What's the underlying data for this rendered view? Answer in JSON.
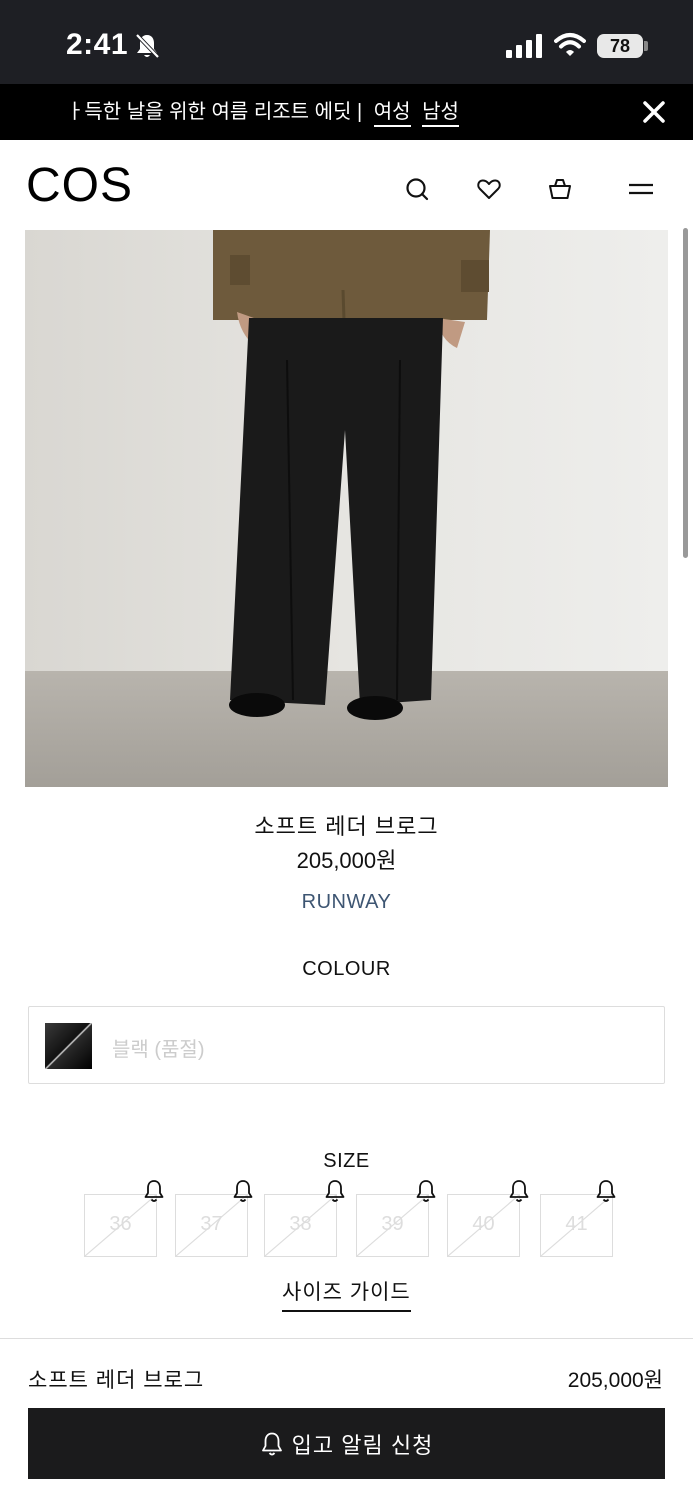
{
  "status_bar": {
    "time": "2:41",
    "battery": "78"
  },
  "promo": {
    "text": "ㅏ득한 날을 위한 여름 리조트 에딧 |",
    "link_women": "여성",
    "link_men": "남성"
  },
  "header": {
    "logo": "COS"
  },
  "product": {
    "title": "소프트 레더 브로그",
    "price": "205,000원",
    "collection": "RUNWAY",
    "colour_label": "COLOUR",
    "colour_value": "블랙 (품절)",
    "size_label": "SIZE",
    "sizes": [
      "36",
      "37",
      "38",
      "39",
      "40",
      "41"
    ],
    "size_guide": "사이즈 가이드"
  },
  "bottom_bar": {
    "name": "소프트 레더 브로그",
    "price": "205,000원",
    "notify_label": "입고 알림 신청"
  },
  "colors": {
    "runway": "#3d5572",
    "button": "#1b1b1c",
    "status_bar": "#1e1f24"
  }
}
